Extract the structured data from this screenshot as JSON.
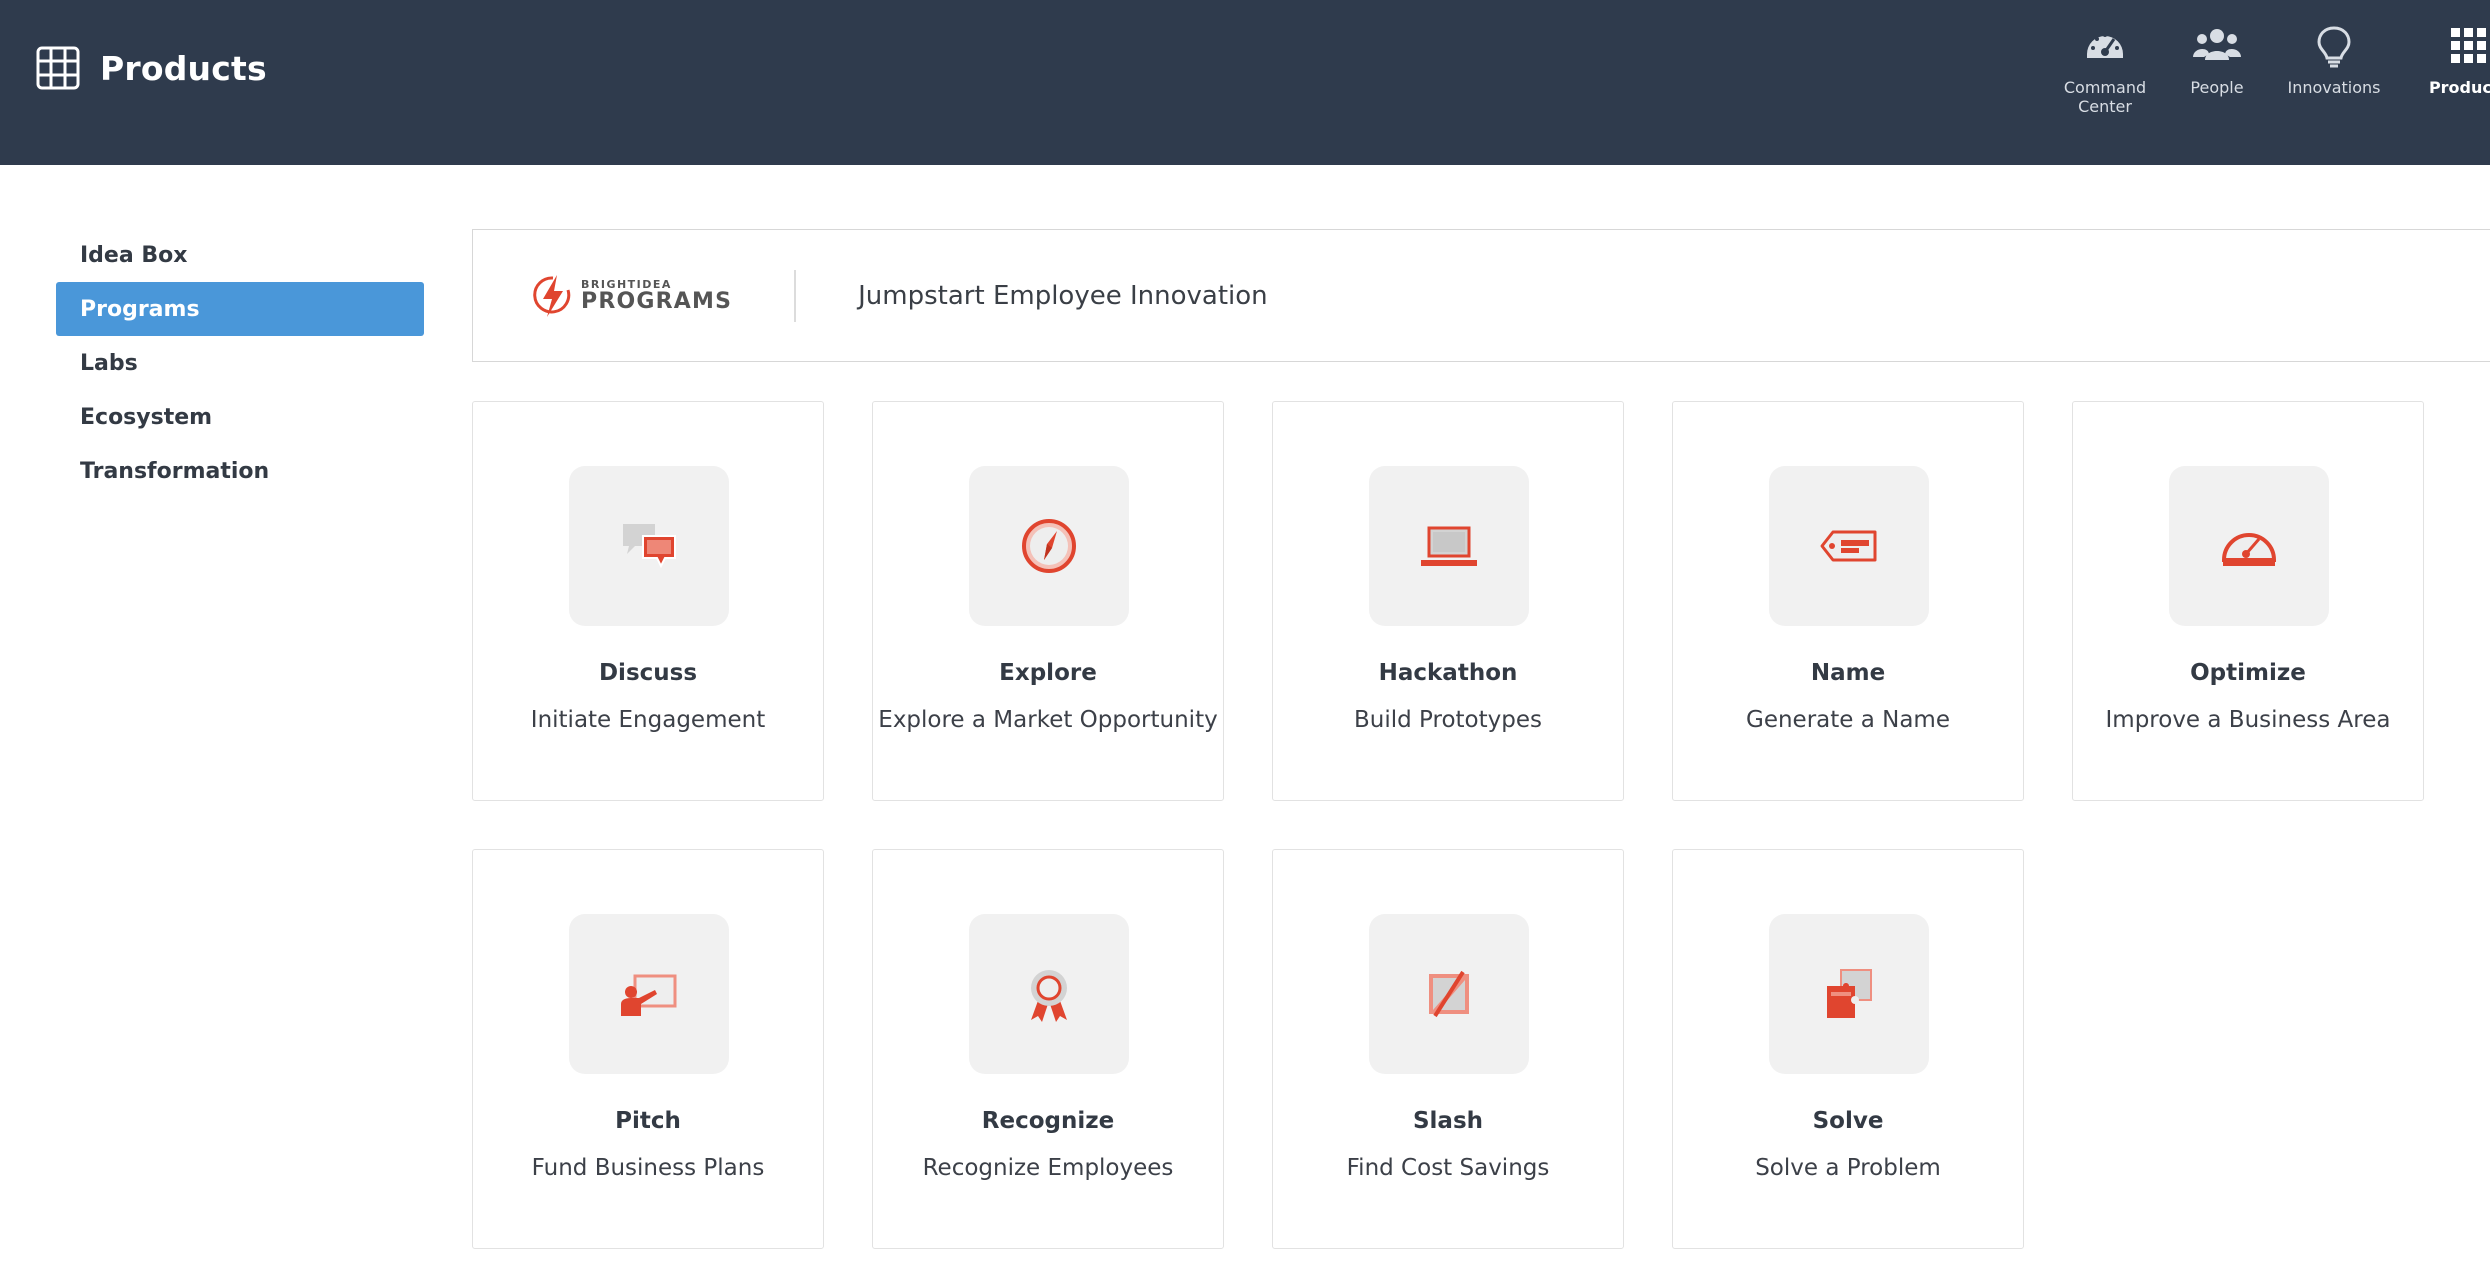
{
  "header": {
    "title": "Products",
    "icon": "grid-icon",
    "nav": [
      {
        "label_line1": "Command",
        "label_line2": "Center",
        "icon": "gauge-icon"
      },
      {
        "label_line1": "People",
        "label_line2": "",
        "icon": "people-icon"
      },
      {
        "label_line1": "Innovations",
        "label_line2": "",
        "icon": "lightbulb-icon"
      },
      {
        "label_line1": "Products",
        "label_line2": "",
        "icon": "apps-grid-icon",
        "active": true
      }
    ]
  },
  "sidebar": {
    "items": [
      {
        "label": "Idea Box",
        "active": false
      },
      {
        "label": "Programs",
        "active": true
      },
      {
        "label": "Labs",
        "active": false
      },
      {
        "label": "Ecosystem",
        "active": false
      },
      {
        "label": "Transformation",
        "active": false
      }
    ]
  },
  "banner": {
    "logo_small": "BRIGHTIDEA",
    "logo_big": "PROGRAMS",
    "tagline": "Jumpstart Employee Innovation"
  },
  "programs": [
    {
      "title": "Discuss",
      "subtitle": "Initiate Engagement",
      "icon": "chat-bubbles-icon"
    },
    {
      "title": "Explore",
      "subtitle": "Explore a Market Opportunity",
      "icon": "compass-icon"
    },
    {
      "title": "Hackathon",
      "subtitle": "Build Prototypes",
      "icon": "laptop-icon"
    },
    {
      "title": "Name",
      "subtitle": "Generate a Name",
      "icon": "tag-icon"
    },
    {
      "title": "Optimize",
      "subtitle": "Improve a Business Area",
      "icon": "gauge-icon"
    },
    {
      "title": "Pitch",
      "subtitle": "Fund Business Plans",
      "icon": "presenter-icon"
    },
    {
      "title": "Recognize",
      "subtitle": "Recognize Employees",
      "icon": "award-ribbon-icon"
    },
    {
      "title": "Slash",
      "subtitle": "Find Cost Savings",
      "icon": "slash-icon"
    },
    {
      "title": "Solve",
      "subtitle": "Solve a Problem",
      "icon": "puzzle-icon"
    }
  ],
  "colors": {
    "header_bg": "#2f3b4d",
    "active_blue": "#4a97d9",
    "accent_red": "#e0452f",
    "icon_gray": "#d3d3d3"
  }
}
